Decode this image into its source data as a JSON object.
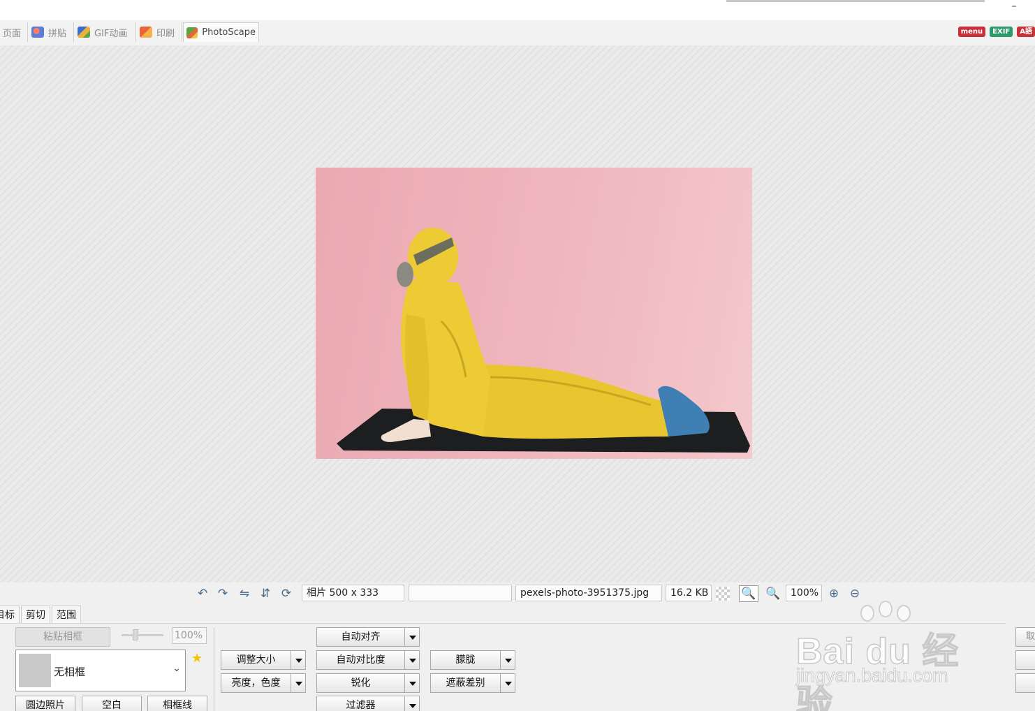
{
  "window": {
    "minimize_glyph": "–"
  },
  "tabs": [
    {
      "label": "页面",
      "icon": "page-icon",
      "color": "#888888"
    },
    {
      "label": "拼贴",
      "icon": "combine-icon",
      "color": "#5b7fd6"
    },
    {
      "label": "GIF动画",
      "icon": "gif-animation-icon",
      "color": "#3c6bd1"
    },
    {
      "label": "印刷",
      "icon": "print-icon",
      "color": "#e8643a"
    },
    {
      "label": "PhotoScape",
      "icon": "photoscape-icon",
      "color": "#5aa641"
    }
  ],
  "badges": [
    {
      "label": "menu",
      "color": "#c8303a"
    },
    {
      "label": "EXIF",
      "color": "#2d9a6c"
    },
    {
      "label": "A語",
      "color": "#c8303a"
    }
  ],
  "status": {
    "photo_size": "相片 500 x 333",
    "empty_field": "",
    "filename": "pexels-photo-3951375.jpg",
    "filesize": "16.2 KB",
    "zoom": "100%"
  },
  "panel_tabs": [
    "目标",
    "剪切",
    "范围"
  ],
  "frame_panel": {
    "paste_frame": "粘贴相框",
    "opacity": "100%",
    "frame_name": "无相框",
    "round_photo": "圆边照片",
    "blank": "空白",
    "frame_line": "相框线"
  },
  "tools": {
    "resize": "调整大小",
    "brightness_color": "亮度，色度",
    "auto_level": "自动对齐",
    "auto_contrast": "自动对比度",
    "sharpen": "锐化",
    "filter": "过滤器",
    "blur": "朦胧",
    "backlight": "遮蔽差别"
  },
  "right_buttons": [
    "取",
    "",
    ""
  ],
  "watermark": {
    "main": "Bai du 经验",
    "sub": "jingyan.baidu.com"
  }
}
